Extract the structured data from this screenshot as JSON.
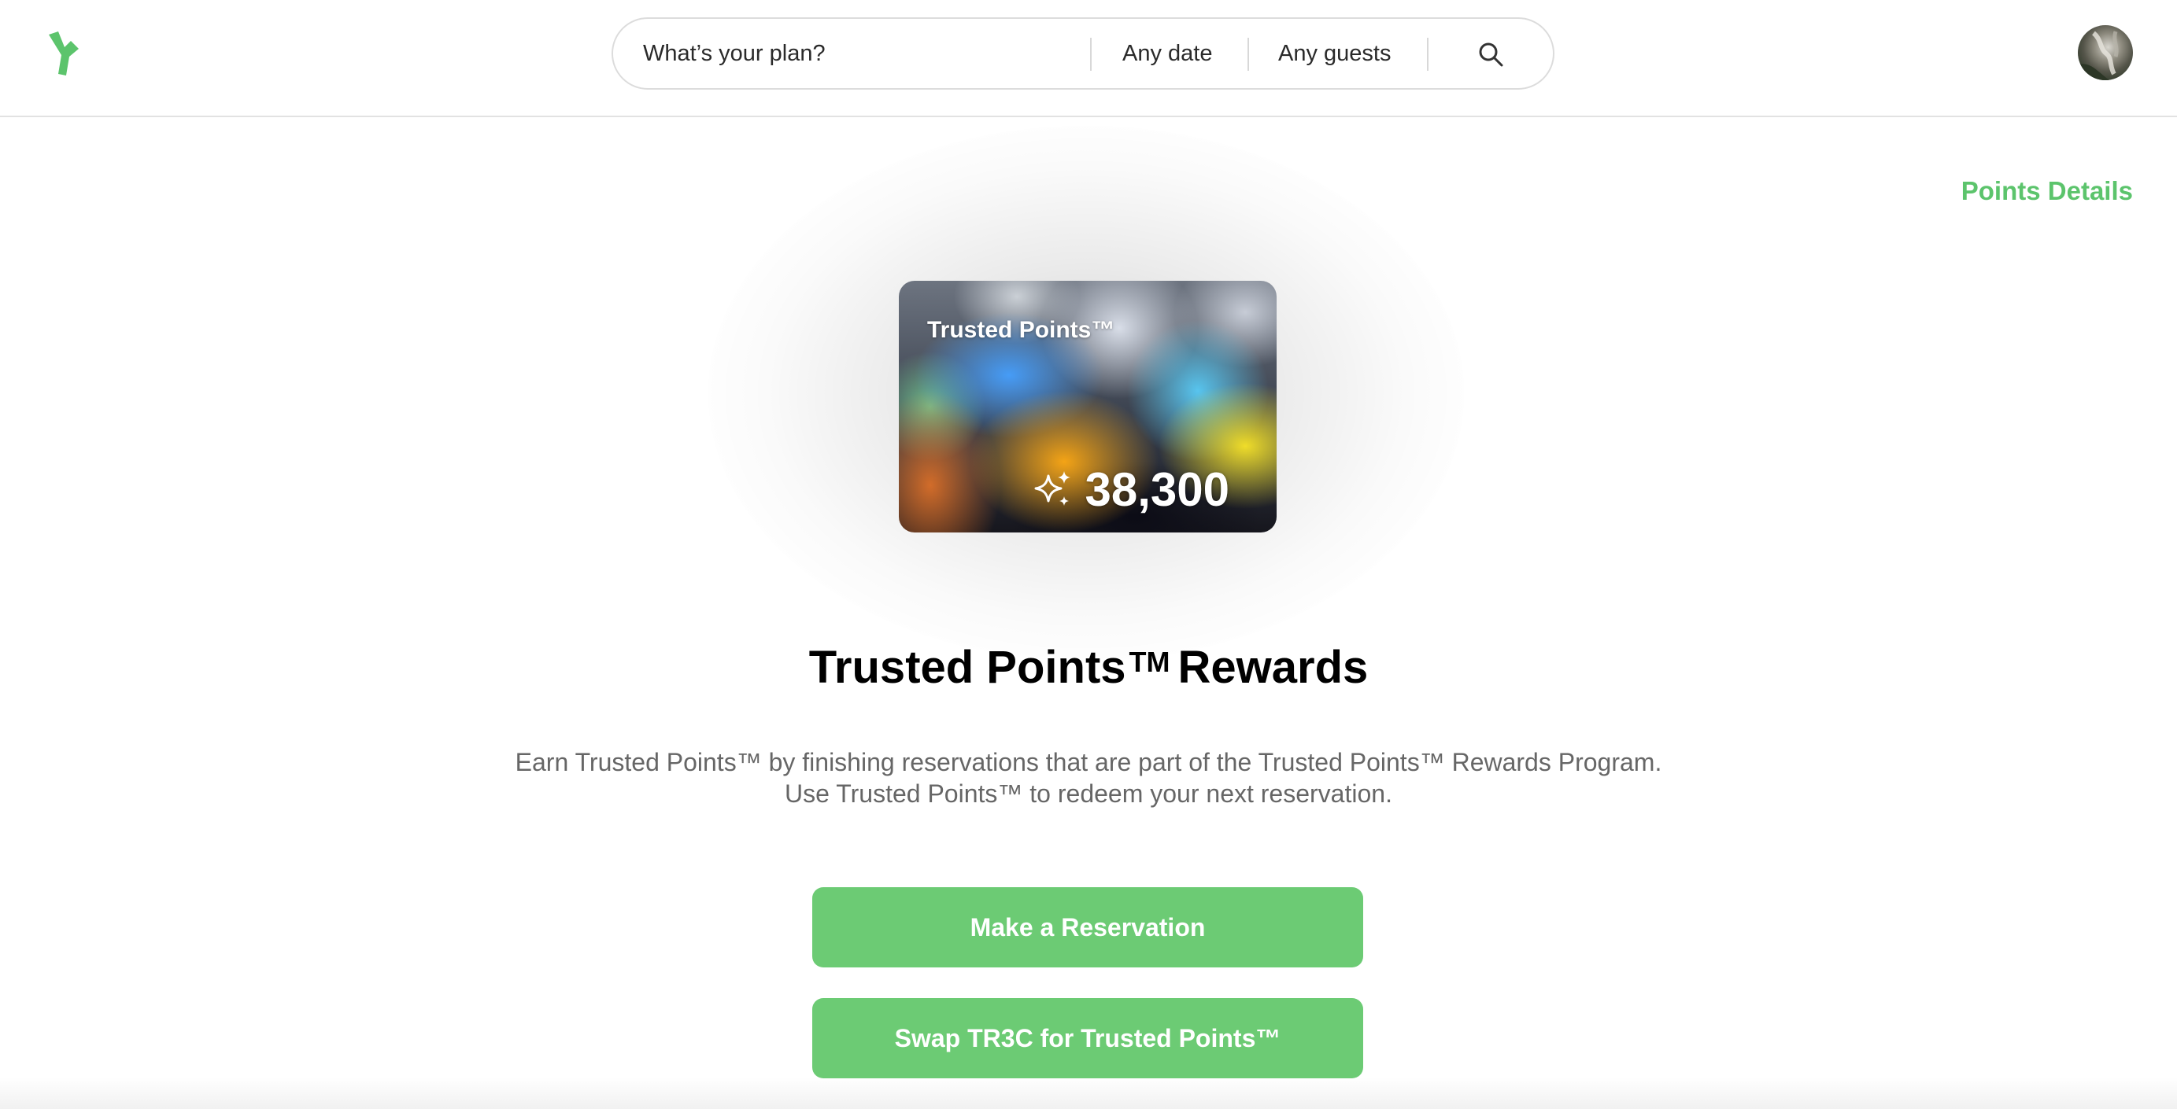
{
  "header": {
    "logo_icon": "green-sprout-logo-icon",
    "search": {
      "placeholder": "What’s your plan?",
      "date_label": "Any date",
      "guests_label": "Any guests",
      "search_icon": "search-icon"
    },
    "avatar_icon": "user-avatar"
  },
  "main": {
    "points_details_link": "Points Details",
    "card": {
      "title": "Trusted Points™",
      "points": "38,300",
      "sparkle_icon": "sparkle-icon"
    },
    "title": {
      "prefix": "Trusted Points",
      "tm": "TM",
      "suffix": "Rewards"
    },
    "description": {
      "line1": "Earn Trusted Points™ by finishing reservations that are part of the Trusted Points™ Rewards Program.",
      "line2": "Use Trusted Points™ to redeem your next reservation."
    },
    "buttons": {
      "reserve": "Make a Reservation",
      "swap": "Swap TR3C for Trusted Points™"
    }
  },
  "colors": {
    "accent_green": "#6ccb74",
    "link_green": "#5cc46c"
  }
}
